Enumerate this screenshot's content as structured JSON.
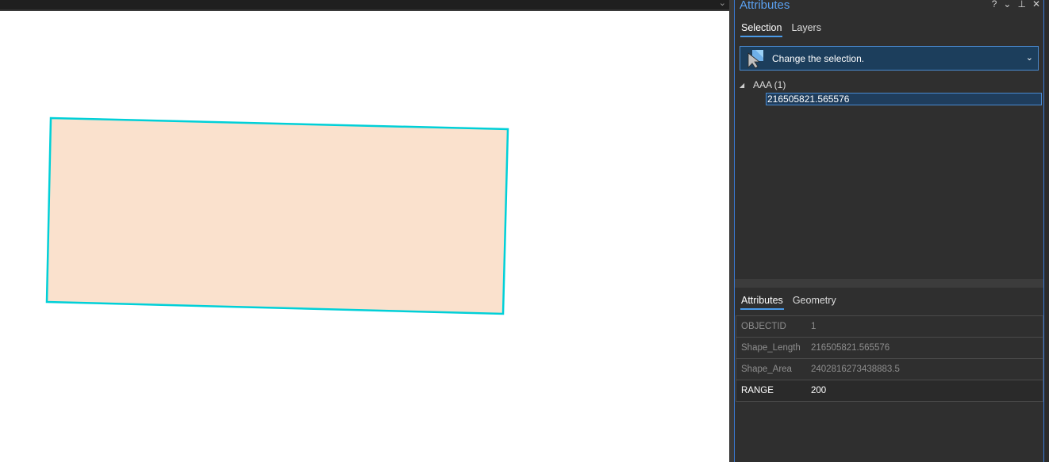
{
  "map": {
    "polygon": {
      "fill": "#fae1cd",
      "outline": "#00d0d8"
    }
  },
  "pane": {
    "title": "Attributes",
    "controls": {
      "help": "?",
      "options": "⌄",
      "pin": "⊥",
      "close": "✕"
    }
  },
  "top_tabs": [
    {
      "label": "Selection",
      "active": true
    },
    {
      "label": "Layers",
      "active": false
    }
  ],
  "selection_dropdown": {
    "label": "Change the selection.",
    "icon": "select-cursor-icon"
  },
  "tree": {
    "layer_label": "AAA (1)",
    "feature_label": "216505821.565576"
  },
  "bottom_tabs": [
    {
      "label": "Attributes",
      "active": true
    },
    {
      "label": "Geometry",
      "active": false
    }
  ],
  "attributes": [
    {
      "field": "OBJECTID",
      "value": "1",
      "editable": false
    },
    {
      "field": "Shape_Length",
      "value": "216505821.565576",
      "editable": false
    },
    {
      "field": "Shape_Area",
      "value": "2402816273438883.5",
      "editable": false
    },
    {
      "field": "RANGE",
      "value": "200",
      "editable": true
    }
  ],
  "colors": {
    "accent": "#4a9ae8",
    "panel_bg": "#2f2f2f",
    "selection_bg": "#1c3e5c"
  }
}
